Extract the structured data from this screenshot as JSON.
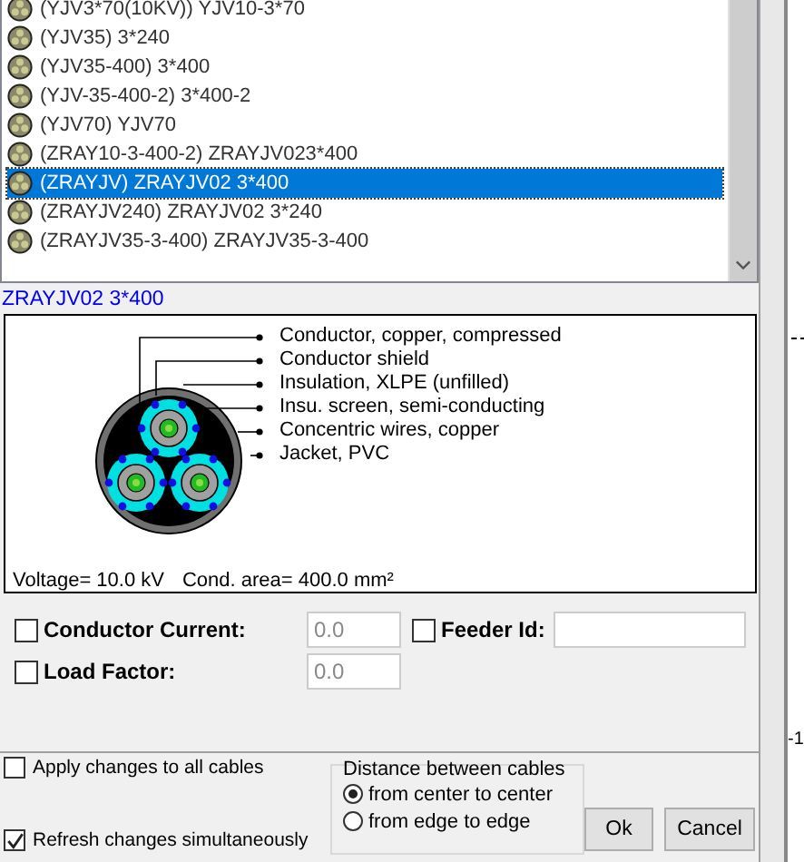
{
  "cable_list": {
    "items": [
      {
        "label": "(YJV3*70(10KV)) YJV10-3*70",
        "selected": false
      },
      {
        "label": "(YJV35) 3*240",
        "selected": false
      },
      {
        "label": "(YJV35-400) 3*400",
        "selected": false
      },
      {
        "label": "(YJV-35-400-2) 3*400-2",
        "selected": false
      },
      {
        "label": "(YJV70) YJV70",
        "selected": false
      },
      {
        "label": "(ZRAY10-3-400-2) ZRAYJV023*400",
        "selected": false
      },
      {
        "label": "(ZRAYJV) ZRAYJV02 3*400",
        "selected": true
      },
      {
        "label": "(ZRAYJV240) ZRAYJV02 3*240",
        "selected": false
      },
      {
        "label": "(ZRAYJV35-3-400) ZRAYJV35-3-400",
        "selected": false
      }
    ]
  },
  "cable_name": "ZRAYJV02 3*400",
  "diagram": {
    "layers": [
      "Conductor, copper, compressed",
      "Conductor shield",
      "Insulation, XLPE (unfilled)",
      "Insu. screen, semi-conducting",
      "Concentric wires, copper",
      "Jacket, PVC"
    ],
    "voltage": "Voltage= 10.0 kV",
    "area": "Cond. area= 400.0 mm²"
  },
  "options": {
    "conductor_current": {
      "label": "Conductor Current:",
      "checked": false,
      "value": "0.0"
    },
    "feeder_id": {
      "label": "Feeder Id:",
      "checked": false
    },
    "load_factor": {
      "label": "Load Factor:",
      "checked": false,
      "value": "0.0"
    }
  },
  "apply_all": {
    "label": "Apply changes to all cables",
    "checked": false
  },
  "refresh": {
    "label": "Refresh changes simultaneously",
    "checked": true
  },
  "distance": {
    "title": "Distance between cables",
    "options": [
      {
        "label": "from center to center",
        "selected": true
      },
      {
        "label": "from edge to edge",
        "selected": false
      }
    ]
  },
  "buttons": [
    "Ok",
    "Cancel"
  ],
  "background_text": "-1"
}
